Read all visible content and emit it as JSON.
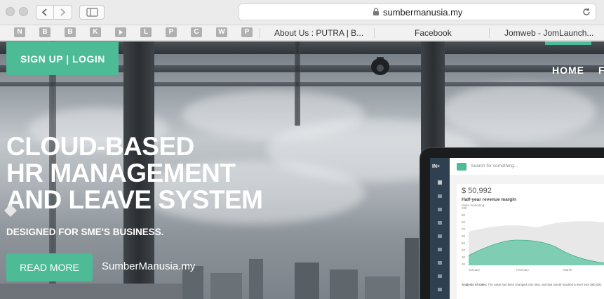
{
  "browser": {
    "url": "sumbermanusia.my",
    "bookmarks_icons": [
      "N",
      "B",
      "B",
      "K",
      "",
      "L",
      "P",
      "C",
      "W",
      "P"
    ],
    "bookmarks": [
      "About Us : PUTRA | B...",
      "Facebook",
      "Jomweb - JomLaunch..."
    ]
  },
  "site": {
    "signup_login": "SIGN UP |  LOGIN",
    "nav_home": "HOME",
    "nav_next": "F",
    "headline": [
      "CLOUD-BASED",
      "HR MANAGEMENT",
      "AND LEAVE SYSTEM"
    ],
    "tagline": "DESIGNED FOR SME'S BUSINESS.",
    "read_more": "READ MORE",
    "brand": "SumberManusia.my"
  },
  "device": {
    "app_logo": "IN+",
    "search_placeholder": "Search for something...",
    "amount": "$ 50,992",
    "chart_title": "Half-year revenue margin",
    "chart_subtitle": "Sales marketing",
    "y_ticks": [
      "100",
      "90",
      "80",
      "70",
      "60",
      "50",
      "40",
      "30",
      "20"
    ],
    "x_ticks": [
      "January",
      "February",
      "March"
    ],
    "analysis_label": "Analysis of sales:",
    "analysis_text": "The value has been changed over time, and last month reached a level over $50,000."
  },
  "colors": {
    "accent": "#4dbb96",
    "hero_text": "#ffffff"
  }
}
